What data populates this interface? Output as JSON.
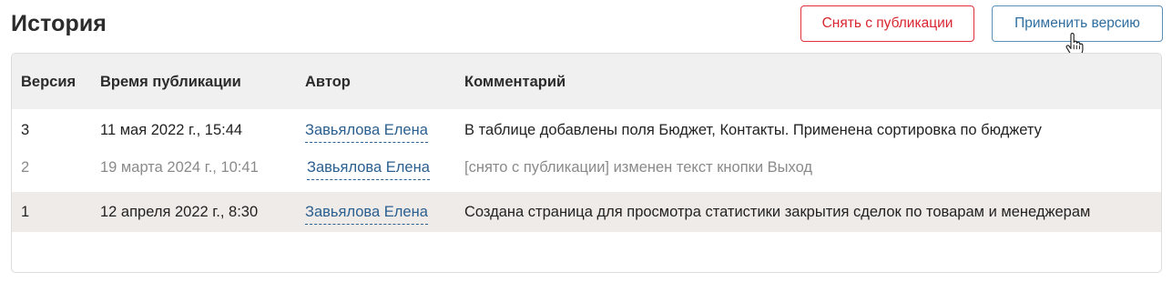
{
  "page": {
    "title": "История"
  },
  "toolbar": {
    "unpublish_label": "Снять с публикации",
    "apply_label": "Применить версию"
  },
  "table": {
    "columns": {
      "version": "Версия",
      "time": "Время публикации",
      "author": "Автор",
      "comment": "Комментарий"
    },
    "rows": [
      {
        "version": "3",
        "time": "11 мая 2022 г., 15:44",
        "author": "Завьялова Елена",
        "comment": "В таблице добавлены поля Бюджет, Контакты. Применена сортировка по бюджету"
      },
      {
        "version": "2",
        "time": "19 марта 2024 г., 10:41",
        "author": "Завьялова Елена",
        "comment": "[снято с публикации] изменен текст кнопки Выход"
      },
      {
        "version": "1",
        "time": "12 апреля 2022 г., 8:30",
        "author": "Завьялова Елена",
        "comment": "Создана страница для просмотра статистики закрытия сделок по товарам и менеджерам"
      }
    ]
  },
  "colors": {
    "danger": "#d9252f",
    "primary": "#2f6e9e",
    "link": "#2a5f8f",
    "header_bg": "#f0f0f0",
    "selected_row_bg": "#efebe9",
    "muted_text": "#8a8a8a"
  },
  "icons": {
    "cursor": "hand-pointer-icon"
  }
}
